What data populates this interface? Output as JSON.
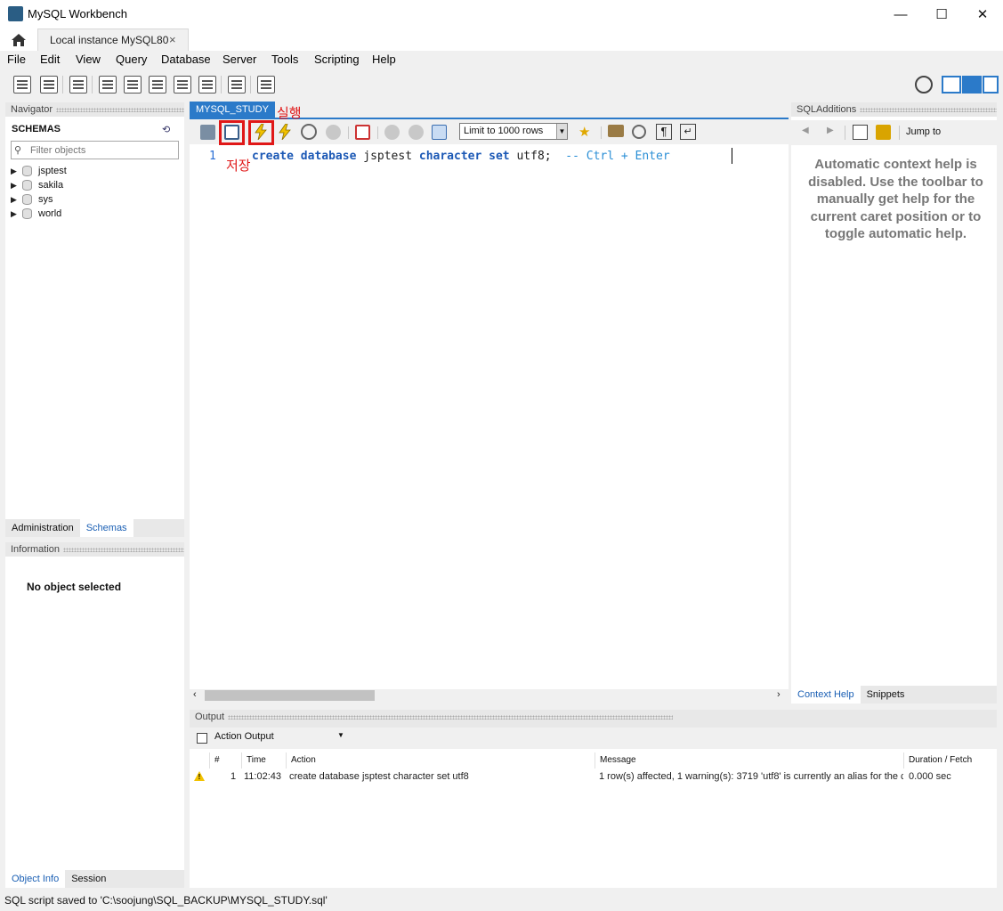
{
  "window": {
    "title": "MySQL Workbench"
  },
  "tabs": {
    "connection_label": "Local instance MySQL80",
    "close": "×"
  },
  "menu": [
    "File",
    "Edit",
    "View",
    "Query",
    "Database",
    "Server",
    "Tools",
    "Scripting",
    "Help"
  ],
  "navigator": {
    "header": "Navigator",
    "schemas_title": "SCHEMAS",
    "filter_placeholder": "Filter objects",
    "schemas": [
      "jsptest",
      "sakila",
      "sys",
      "world"
    ],
    "bottom_tabs": [
      "Administration",
      "Schemas"
    ]
  },
  "information": {
    "header": "Information",
    "empty": "No object selected",
    "bottom_tabs": [
      "Object Info",
      "Session"
    ]
  },
  "editor": {
    "tab_label": "MYSQL_STUDY",
    "limit_label": "Limit to 1000 rows",
    "line_number": "1",
    "code": {
      "kw1": "create",
      "kw2": "database",
      "ident": "jsptest",
      "kw3": "character",
      "kw4": "set",
      "tail": "utf8;",
      "comment": "-- Ctrl + Enter"
    }
  },
  "annotations": {
    "save": "저장",
    "execute": "실행"
  },
  "sql_additions": {
    "header": "SQLAdditions",
    "jump_to": "Jump to",
    "help_text": "Automatic context help is disabled. Use the toolbar to manually get help for the current caret position or to toggle automatic help.",
    "bottom_tabs": [
      "Context Help",
      "Snippets"
    ]
  },
  "output": {
    "header": "Output",
    "mode": "Action Output",
    "columns": [
      "#",
      "Time",
      "Action",
      "Message",
      "Duration / Fetch"
    ],
    "rows": [
      {
        "num": "1",
        "time": "11:02:43",
        "action": "create database jsptest character set utf8",
        "message": "1 row(s) affected, 1 warning(s): 3719 'utf8' is currently an alias for the c...",
        "duration": "0.000 sec"
      }
    ]
  },
  "status": {
    "text": "SQL script saved to 'C:\\soojung\\SQL_BACKUP\\MYSQL_STUDY.sql'"
  },
  "colors": {
    "accent": "#2b7ac9",
    "keyword": "#1b58b5",
    "annotation": "#e01818",
    "warning": "#f2c200"
  }
}
